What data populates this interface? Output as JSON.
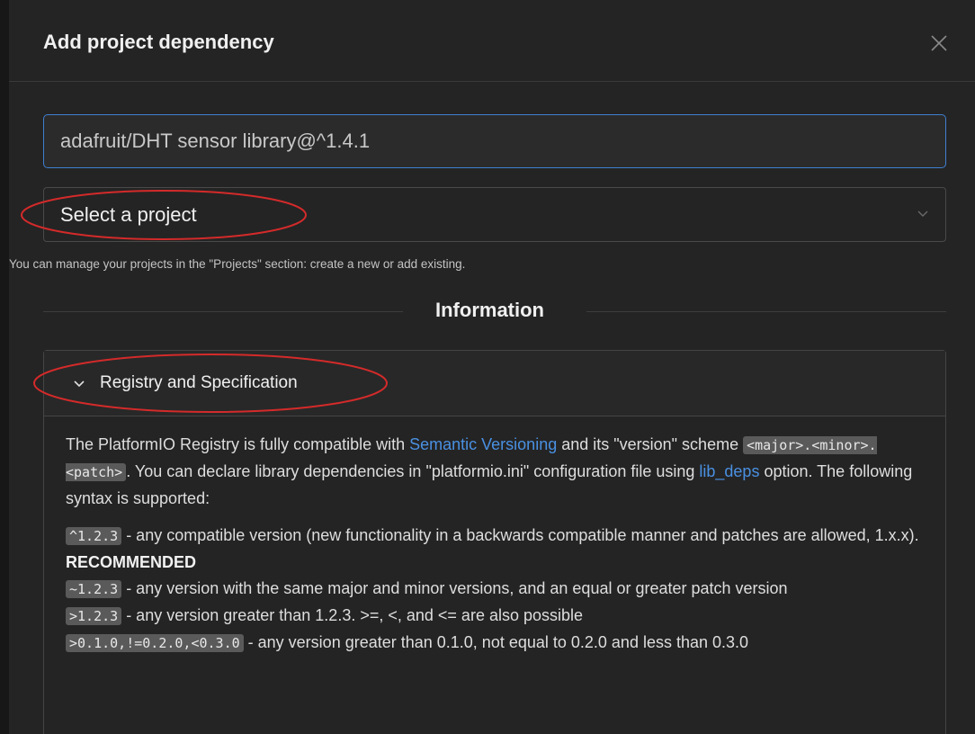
{
  "dialog": {
    "title": "Add project dependency",
    "close_icon": "close-icon"
  },
  "dependency_input": {
    "value": "adafruit/DHT sensor library@^1.4.1"
  },
  "project_select": {
    "selected": "Select a project",
    "chevron_icon": "chevron-down-icon"
  },
  "helper_text": "You can manage your projects in the \"Projects\" section: create a new or add existing.",
  "information": {
    "title": "Information"
  },
  "registry_panel": {
    "title": "Registry and Specification",
    "chevron_icon": "chevron-down-icon",
    "intro": {
      "t1": "The PlatformIO Registry is fully compatible with ",
      "link_semver": "Semantic Versioning",
      "t2": " and its \"version\" scheme ",
      "code_scheme": "<major>.<minor>.<patch>",
      "t3": ". You can declare library dependencies in \"platformio.ini\" configuration file using ",
      "link_lib_deps": "lib_deps",
      "t4": " option. The following syntax is supported:"
    },
    "rules": [
      {
        "code": "^1.2.3",
        "text": " - any compatible version (new functionality in a backwards compatible manner and patches are allowed, 1.x.x). ",
        "bold": "RECOMMENDED"
      },
      {
        "code": "~1.2.3",
        "text": " - any version with the same major and minor versions, and an equal or greater patch version"
      },
      {
        "code": ">1.2.3",
        "text": " - any version greater than 1.2.3. >=, <, and <= are also possible"
      },
      {
        "code": ">0.1.0,!=0.2.0,<0.3.0",
        "text": " - any version greater than 0.1.0, not equal to 0.2.0 and less than 0.3.0"
      }
    ]
  },
  "colors": {
    "background": "#242424",
    "accent": "#3f7fd0",
    "link": "#4a90e2",
    "annotation": "#d42a2a"
  }
}
